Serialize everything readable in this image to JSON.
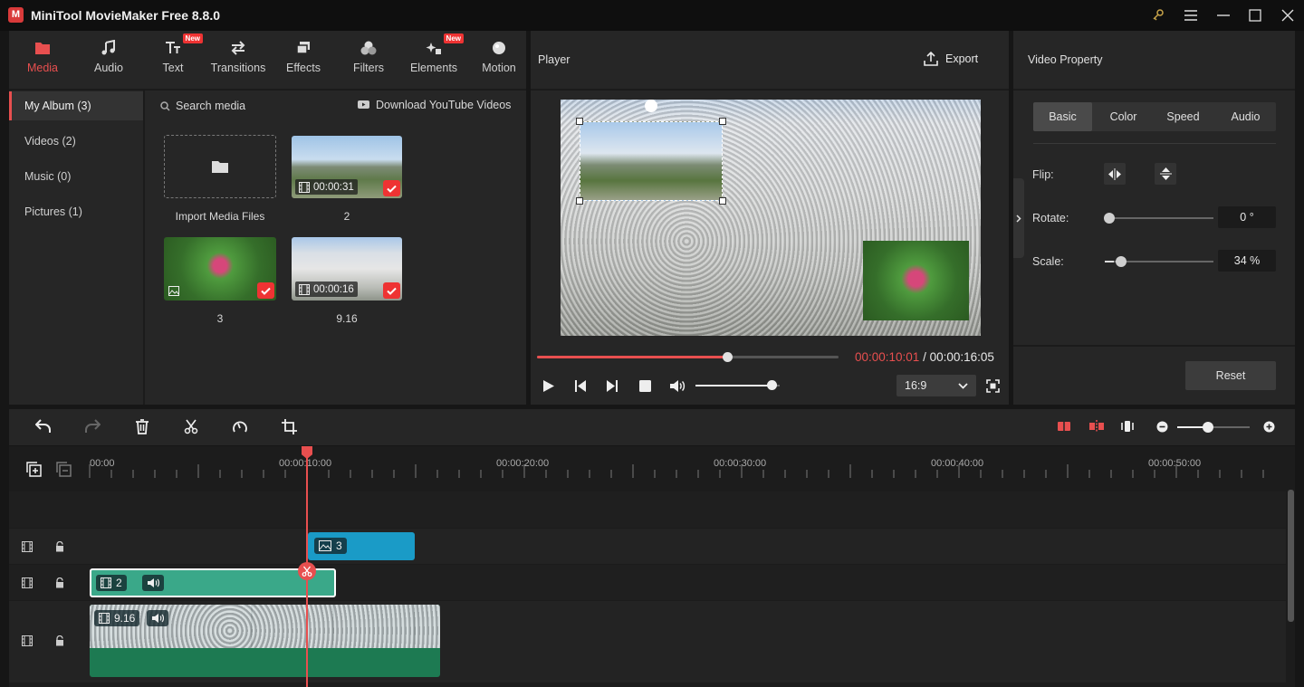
{
  "app": {
    "title": "MiniTool MovieMaker Free 8.8.0",
    "logo_letter": "M"
  },
  "tabs": [
    {
      "label": "Media",
      "icon": "folder-icon",
      "active": true
    },
    {
      "label": "Audio",
      "icon": "music-note-icon"
    },
    {
      "label": "Text",
      "icon": "text-icon",
      "badge": "New"
    },
    {
      "label": "Transitions",
      "icon": "swap-arrows-icon"
    },
    {
      "label": "Effects",
      "icon": "layers-icon"
    },
    {
      "label": "Filters",
      "icon": "circles-icon"
    },
    {
      "label": "Elements",
      "icon": "sparkle-icon",
      "badge": "New"
    },
    {
      "label": "Motion",
      "icon": "motion-sphere-icon"
    }
  ],
  "album": {
    "items": [
      "My Album (3)",
      "Videos (2)",
      "Music (0)",
      "Pictures (1)"
    ],
    "search_placeholder": "Search media",
    "download_label": "Download YouTube Videos",
    "import_label": "Import Media Files"
  },
  "media_items": [
    {
      "name": "2",
      "duration": "00:00:31",
      "type": "video"
    },
    {
      "name": "3",
      "type": "image"
    },
    {
      "name": "9.16",
      "duration": "00:00:16",
      "type": "video"
    }
  ],
  "player": {
    "title": "Player",
    "export_label": "Export",
    "current_time": "00:00:10:01",
    "separator": " / ",
    "total_time": "00:00:16:05",
    "aspect_ratio": "16:9",
    "progress": 0.63,
    "volume": 0.9
  },
  "property": {
    "title": "Video Property",
    "tabs": [
      "Basic",
      "Color",
      "Speed",
      "Audio"
    ],
    "flip_label": "Flip:",
    "rotate_label": "Rotate:",
    "rotate_value": "0 °",
    "rotate_level": 0.0,
    "scale_label": "Scale:",
    "scale_value": "34 %",
    "scale_level": 0.08,
    "reset_label": "Reset"
  },
  "timeline": {
    "ticks": [
      "00:00",
      "00:00:10:00",
      "00:00:20:00",
      "00:00:30:00",
      "00:00:40:00",
      "00:00:50:00"
    ],
    "zoom_level": 0.42,
    "clips": [
      {
        "name": "3",
        "track": 1,
        "type": "image"
      },
      {
        "name": "2",
        "track": 2,
        "type": "video"
      },
      {
        "name": "9.16",
        "track": 3,
        "type": "video"
      }
    ]
  },
  "colors": {
    "accent": "#e84f4f",
    "image_clip": "#1a9bc7",
    "video_clip": "#3aa889",
    "video_clip_dark": "#1d7a52"
  }
}
